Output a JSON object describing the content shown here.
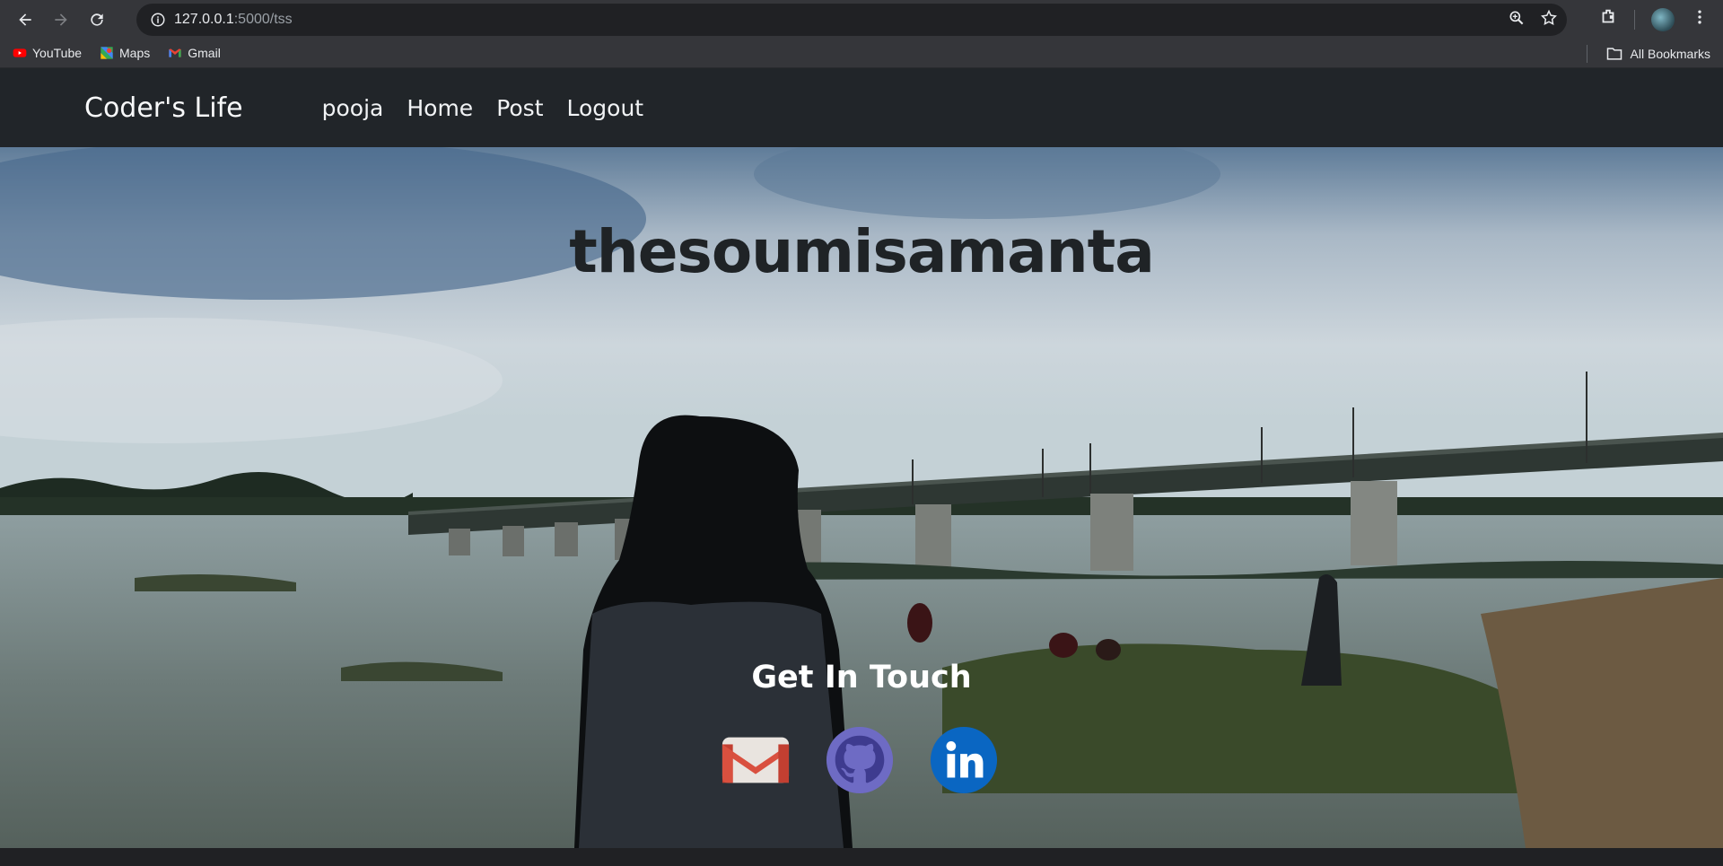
{
  "browser": {
    "url_host": "127.0.0.1",
    "url_path": ":5000/tss",
    "bookmarks": [
      {
        "label": "YouTube",
        "icon": "youtube-icon"
      },
      {
        "label": "Maps",
        "icon": "maps-icon"
      },
      {
        "label": "Gmail",
        "icon": "gmail-icon"
      }
    ],
    "all_bookmarks_label": "All Bookmarks"
  },
  "site": {
    "brand": "Coder's Life",
    "nav": [
      "pooja",
      "Home",
      "Post",
      "Logout"
    ]
  },
  "hero": {
    "title": "thesoumisamanta",
    "contact_heading": "Get In Touch",
    "socials": [
      "gmail-icon",
      "github-icon",
      "linkedin-icon"
    ]
  },
  "colors": {
    "navbar_bg": "#212529",
    "chrome_bg": "#35363a",
    "linkedin_blue": "#0a66c2",
    "github_purple": "#6e6bc4",
    "gmail_red": "#d9503f"
  }
}
